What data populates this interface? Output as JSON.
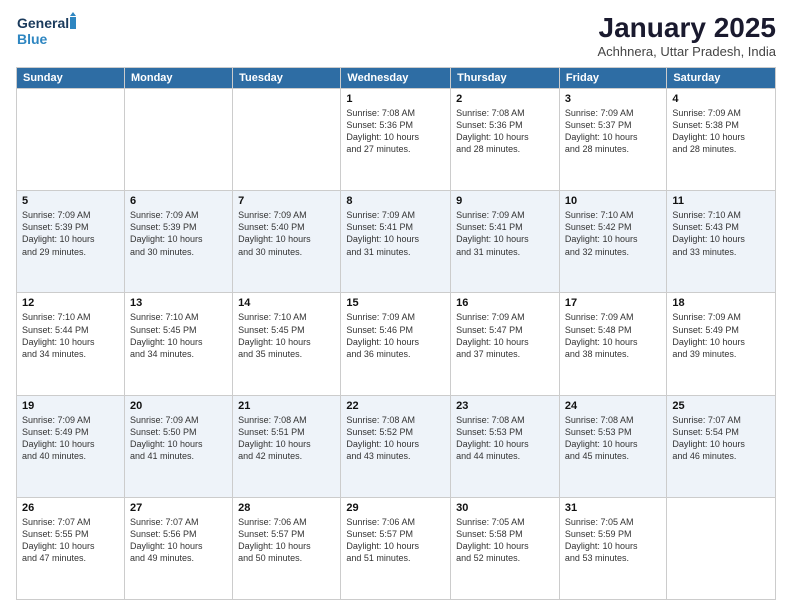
{
  "header": {
    "logo_line1": "General",
    "logo_line2": "Blue",
    "title": "January 2025",
    "subtitle": "Achhnera, Uttar Pradesh, India"
  },
  "weekdays": [
    "Sunday",
    "Monday",
    "Tuesday",
    "Wednesday",
    "Thursday",
    "Friday",
    "Saturday"
  ],
  "weeks": [
    [
      {
        "day": "",
        "info": ""
      },
      {
        "day": "",
        "info": ""
      },
      {
        "day": "",
        "info": ""
      },
      {
        "day": "1",
        "info": "Sunrise: 7:08 AM\nSunset: 5:36 PM\nDaylight: 10 hours\nand 27 minutes."
      },
      {
        "day": "2",
        "info": "Sunrise: 7:08 AM\nSunset: 5:36 PM\nDaylight: 10 hours\nand 28 minutes."
      },
      {
        "day": "3",
        "info": "Sunrise: 7:09 AM\nSunset: 5:37 PM\nDaylight: 10 hours\nand 28 minutes."
      },
      {
        "day": "4",
        "info": "Sunrise: 7:09 AM\nSunset: 5:38 PM\nDaylight: 10 hours\nand 28 minutes."
      }
    ],
    [
      {
        "day": "5",
        "info": "Sunrise: 7:09 AM\nSunset: 5:39 PM\nDaylight: 10 hours\nand 29 minutes."
      },
      {
        "day": "6",
        "info": "Sunrise: 7:09 AM\nSunset: 5:39 PM\nDaylight: 10 hours\nand 30 minutes."
      },
      {
        "day": "7",
        "info": "Sunrise: 7:09 AM\nSunset: 5:40 PM\nDaylight: 10 hours\nand 30 minutes."
      },
      {
        "day": "8",
        "info": "Sunrise: 7:09 AM\nSunset: 5:41 PM\nDaylight: 10 hours\nand 31 minutes."
      },
      {
        "day": "9",
        "info": "Sunrise: 7:09 AM\nSunset: 5:41 PM\nDaylight: 10 hours\nand 31 minutes."
      },
      {
        "day": "10",
        "info": "Sunrise: 7:10 AM\nSunset: 5:42 PM\nDaylight: 10 hours\nand 32 minutes."
      },
      {
        "day": "11",
        "info": "Sunrise: 7:10 AM\nSunset: 5:43 PM\nDaylight: 10 hours\nand 33 minutes."
      }
    ],
    [
      {
        "day": "12",
        "info": "Sunrise: 7:10 AM\nSunset: 5:44 PM\nDaylight: 10 hours\nand 34 minutes."
      },
      {
        "day": "13",
        "info": "Sunrise: 7:10 AM\nSunset: 5:45 PM\nDaylight: 10 hours\nand 34 minutes."
      },
      {
        "day": "14",
        "info": "Sunrise: 7:10 AM\nSunset: 5:45 PM\nDaylight: 10 hours\nand 35 minutes."
      },
      {
        "day": "15",
        "info": "Sunrise: 7:09 AM\nSunset: 5:46 PM\nDaylight: 10 hours\nand 36 minutes."
      },
      {
        "day": "16",
        "info": "Sunrise: 7:09 AM\nSunset: 5:47 PM\nDaylight: 10 hours\nand 37 minutes."
      },
      {
        "day": "17",
        "info": "Sunrise: 7:09 AM\nSunset: 5:48 PM\nDaylight: 10 hours\nand 38 minutes."
      },
      {
        "day": "18",
        "info": "Sunrise: 7:09 AM\nSunset: 5:49 PM\nDaylight: 10 hours\nand 39 minutes."
      }
    ],
    [
      {
        "day": "19",
        "info": "Sunrise: 7:09 AM\nSunset: 5:49 PM\nDaylight: 10 hours\nand 40 minutes."
      },
      {
        "day": "20",
        "info": "Sunrise: 7:09 AM\nSunset: 5:50 PM\nDaylight: 10 hours\nand 41 minutes."
      },
      {
        "day": "21",
        "info": "Sunrise: 7:08 AM\nSunset: 5:51 PM\nDaylight: 10 hours\nand 42 minutes."
      },
      {
        "day": "22",
        "info": "Sunrise: 7:08 AM\nSunset: 5:52 PM\nDaylight: 10 hours\nand 43 minutes."
      },
      {
        "day": "23",
        "info": "Sunrise: 7:08 AM\nSunset: 5:53 PM\nDaylight: 10 hours\nand 44 minutes."
      },
      {
        "day": "24",
        "info": "Sunrise: 7:08 AM\nSunset: 5:53 PM\nDaylight: 10 hours\nand 45 minutes."
      },
      {
        "day": "25",
        "info": "Sunrise: 7:07 AM\nSunset: 5:54 PM\nDaylight: 10 hours\nand 46 minutes."
      }
    ],
    [
      {
        "day": "26",
        "info": "Sunrise: 7:07 AM\nSunset: 5:55 PM\nDaylight: 10 hours\nand 47 minutes."
      },
      {
        "day": "27",
        "info": "Sunrise: 7:07 AM\nSunset: 5:56 PM\nDaylight: 10 hours\nand 49 minutes."
      },
      {
        "day": "28",
        "info": "Sunrise: 7:06 AM\nSunset: 5:57 PM\nDaylight: 10 hours\nand 50 minutes."
      },
      {
        "day": "29",
        "info": "Sunrise: 7:06 AM\nSunset: 5:57 PM\nDaylight: 10 hours\nand 51 minutes."
      },
      {
        "day": "30",
        "info": "Sunrise: 7:05 AM\nSunset: 5:58 PM\nDaylight: 10 hours\nand 52 minutes."
      },
      {
        "day": "31",
        "info": "Sunrise: 7:05 AM\nSunset: 5:59 PM\nDaylight: 10 hours\nand 53 minutes."
      },
      {
        "day": "",
        "info": ""
      }
    ]
  ]
}
